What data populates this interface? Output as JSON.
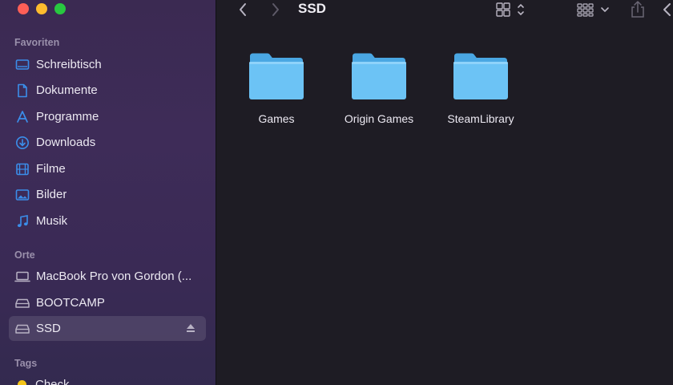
{
  "window": {
    "title": "SSD"
  },
  "sidebar": {
    "favorites_title": "Favoriten",
    "favorites": [
      {
        "label": "Schreibtisch",
        "icon": "desktop-icon"
      },
      {
        "label": "Dokumente",
        "icon": "document-icon"
      },
      {
        "label": "Programme",
        "icon": "applications-icon"
      },
      {
        "label": "Downloads",
        "icon": "download-icon"
      },
      {
        "label": "Filme",
        "icon": "film-icon"
      },
      {
        "label": "Bilder",
        "icon": "photo-icon"
      },
      {
        "label": "Musik",
        "icon": "music-icon"
      }
    ],
    "locations_title": "Orte",
    "locations": [
      {
        "label": "MacBook Pro von Gordon (...",
        "icon": "laptop-icon"
      },
      {
        "label": "BOOTCAMP",
        "icon": "drive-icon"
      },
      {
        "label": "SSD",
        "icon": "drive-icon",
        "selected": true
      }
    ],
    "tags_title": "Tags",
    "tags": [
      {
        "label": "Check",
        "color": "#f5c518"
      }
    ]
  },
  "folders": [
    {
      "label": "Games"
    },
    {
      "label": "Origin Games"
    },
    {
      "label": "SteamLibrary"
    }
  ],
  "colors": {
    "accent": "#3b8eea",
    "folder": "#6cc3f5"
  }
}
